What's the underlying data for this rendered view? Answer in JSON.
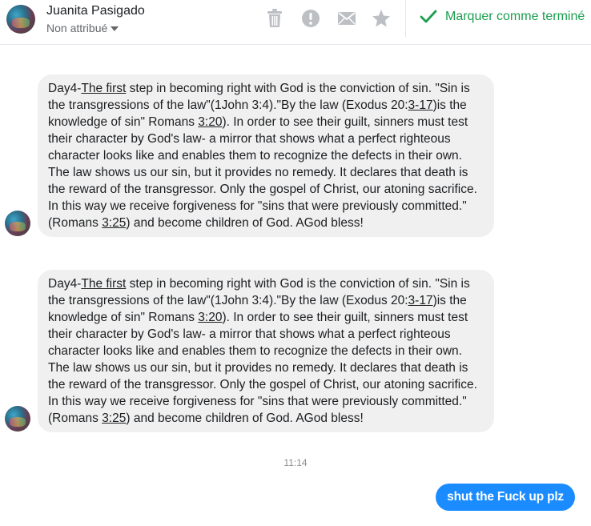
{
  "header": {
    "contact_name": "Juanita Pasigado",
    "assignment": "Non attribué",
    "mark_done_label": "Marquer comme terminé",
    "icons": [
      "trash-icon",
      "alert-icon",
      "mail-icon",
      "star-icon",
      "checkmark-icon"
    ],
    "colors": {
      "done": "#1a9e4f",
      "tool_icon": "#bcc0c4",
      "outgoing": "#1a8cff"
    }
  },
  "messages": [
    {
      "p1": "Day4-",
      "link1": "The first",
      "p2": " step in becoming right with God is the conviction of sin. \"Sin is the transgressions of the law\"(1John 3:4).\"By the  law (Exodus 20:",
      "link2": "3-17",
      "p3": ")is the knowledge of sin\" Romans ",
      "link3": "3:20",
      "p4": "). In order to see their guilt, sinners must test their character by God's law- a mirror that shows what a perfect  righteous character looks like and enables them to recognize the defects in their own. The law  shows us our sin, but it provides no remedy. It declares that death is the reward of the transgressor. Only the gospel of Christ, our atoning sacrifice. In this way we receive forgiveness for \"sins that were previously committed.\"(Romans ",
      "link4": "3:25",
      "p5": ") and become children of God. AGod bless!"
    },
    {
      "p1": "Day4-",
      "link1": "The first",
      "p2": " step in becoming right with God is the conviction of sin. \"Sin is the transgressions of the law\"(1John 3:4).\"By the  law (Exodus 20:",
      "link2": "3-17",
      "p3": ")is the knowledge of sin\" Romans ",
      "link3": "3:20",
      "p4": "). In order to see their guilt, sinners must test their character by God's law- a mirror that shows what a perfect  righteous character looks like and enables them to recognize the defects in their own. The law  shows us our sin, but it provides no remedy. It declares that death is the reward of the transgressor. Only the gospel of Christ, our atoning sacrifice. In this way we receive forgiveness for \"sins that were previously committed.\"(Romans ",
      "link4": "3:25",
      "p5": ") and become children of God. AGod bless!"
    }
  ],
  "timestamp": "11:14",
  "outgoing": {
    "text": "shut the Fuck up plz"
  }
}
